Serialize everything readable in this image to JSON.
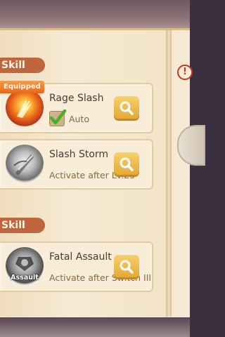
{
  "sections": [
    {
      "tab_label": "Skill"
    },
    {
      "tab_label": "Skill"
    }
  ],
  "skills": [
    {
      "name": "Rage Slash",
      "status": "Auto",
      "badge": "Equipped",
      "auto_checked": true,
      "icon": "flame-slash-icon"
    },
    {
      "name": "Slash Storm",
      "status": "Activate after Lv.25",
      "icon": "sword-storm-icon"
    },
    {
      "name": "Fatal Assault",
      "status": "Activate after Switch III",
      "icon_label": "Assault",
      "icon": "assault-icon"
    }
  ],
  "alert_symbol": "!",
  "colors": {
    "tab": "#c0663e",
    "button": "#e4a732",
    "equipped": "#e5691b",
    "check": "#4caf2a"
  }
}
